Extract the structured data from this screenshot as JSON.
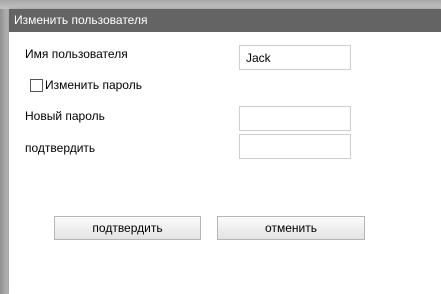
{
  "dialog": {
    "title": "Изменить пользователя"
  },
  "form": {
    "username_label": "Имя пользователя",
    "username_value": "Jack",
    "change_password_label": "Изменить пароль",
    "change_password_checked": false,
    "new_password_label": "Новый пароль",
    "new_password_value": "",
    "confirm_label": "подтвердить",
    "confirm_value": ""
  },
  "buttons": {
    "confirm_label": "подтвердить",
    "cancel_label": "отменить"
  }
}
